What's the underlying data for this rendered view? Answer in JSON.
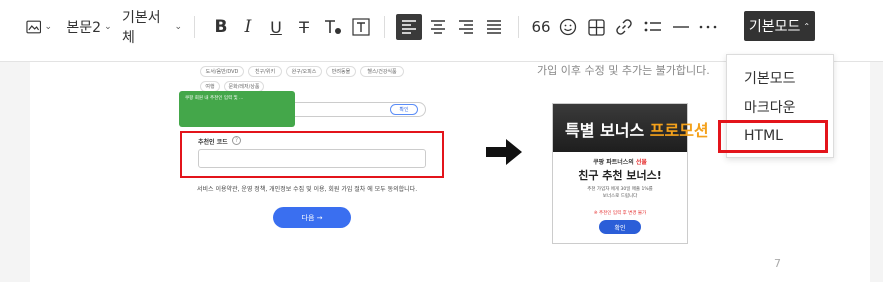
{
  "toolbar": {
    "paragraph_style": "본문2",
    "font_family": "기본서체",
    "bold": "B",
    "italic": "I",
    "underline": "U",
    "strike": "T",
    "quote_mark": "66",
    "editor_mode": "기본모드"
  },
  "mode_menu": {
    "items": [
      {
        "label": "기본모드"
      },
      {
        "label": "마크다운"
      },
      {
        "label": "HTML"
      }
    ],
    "highlight_color": "#e3141b"
  },
  "content": {
    "caption": "가입 이후 수정 및 추가는 불가합니다.",
    "page_number": "7"
  },
  "left_shot": {
    "chips_row1": [
      "도서/음반/DVD",
      "친구/위키",
      "완구/오피스",
      "반려동물",
      "헬스/건강식품"
    ],
    "chips_row2": [
      "여행",
      "문화/레저/상품"
    ],
    "tooltip_text": "쿠팡 회원 내 추천인 입력 및 ...",
    "small_button": "확인",
    "code_label": "추천인 코드",
    "question_icon": "?",
    "terms": "서비스 이용약관, 운영 정책, 개인정보 수집 및 이용, 회원 가입 절차 에 모두 동의합니다.",
    "next_button": "다음 →"
  },
  "right_shot": {
    "banner_prefix": "특별 보너스 ",
    "banner_highlight": "프로모션",
    "line1_prefix": "쿠팡 파트너스의 ",
    "line1_highlight": "선물",
    "title": "친구 추천 보너스!",
    "desc_line1": "추천 가입자 에게 30일 매출 1%를",
    "desc_line2": "보너스로 드립니다",
    "note": "※ 추천인 입력 후 변경 불가",
    "button": "확인"
  }
}
